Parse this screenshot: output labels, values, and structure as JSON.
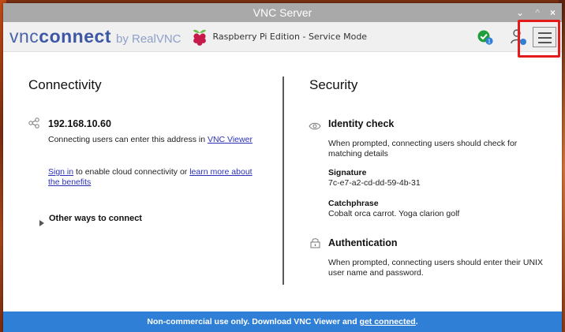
{
  "window": {
    "title": "VNC Server",
    "controls": {
      "minimize": "⌄",
      "maximize": "^",
      "close": "×"
    }
  },
  "header": {
    "logo_vnc": "vnc",
    "logo_connect": "connect",
    "logo_by": "by RealVNC",
    "edition": "Raspberry Pi Edition - Service Mode",
    "status_badge_count": "1"
  },
  "connectivity": {
    "title": "Connectivity",
    "address": "192.168.10.60",
    "address_hint_pre": "Connecting users can enter this address in ",
    "address_hint_link": "VNC Viewer",
    "signin_link": "Sign in",
    "signin_text": " to enable cloud connectivity or ",
    "learn_link": "learn more about the benefits",
    "other_ways": "Other ways to connect"
  },
  "security": {
    "title": "Security",
    "identity_title": "Identity check",
    "identity_text": "When prompted, connecting users should check for matching details",
    "signature_label": "Signature",
    "signature_value": "7c-e7-a2-cd-dd-59-4b-31",
    "catchphrase_label": "Catchphrase",
    "catchphrase_value": "Cobalt orca carrot. Yoga clarion golf",
    "auth_title": "Authentication",
    "auth_text": "When prompted, connecting users should enter their UNIX user name and password."
  },
  "footer": {
    "text": "Non-commercial use only. Download VNC Viewer and ",
    "link": "get connected",
    "end": "."
  },
  "colors": {
    "accent": "#2f7fd6",
    "logo": "#3c57a3",
    "status_ok": "#1f9e3a",
    "highlight": "#e31b1b"
  },
  "icons": [
    "raspberry-pi-icon",
    "status-ok-icon",
    "user-icon",
    "hamburger-menu-icon",
    "share-icon",
    "eye-icon",
    "lock-icon",
    "triangle-right-icon"
  ]
}
